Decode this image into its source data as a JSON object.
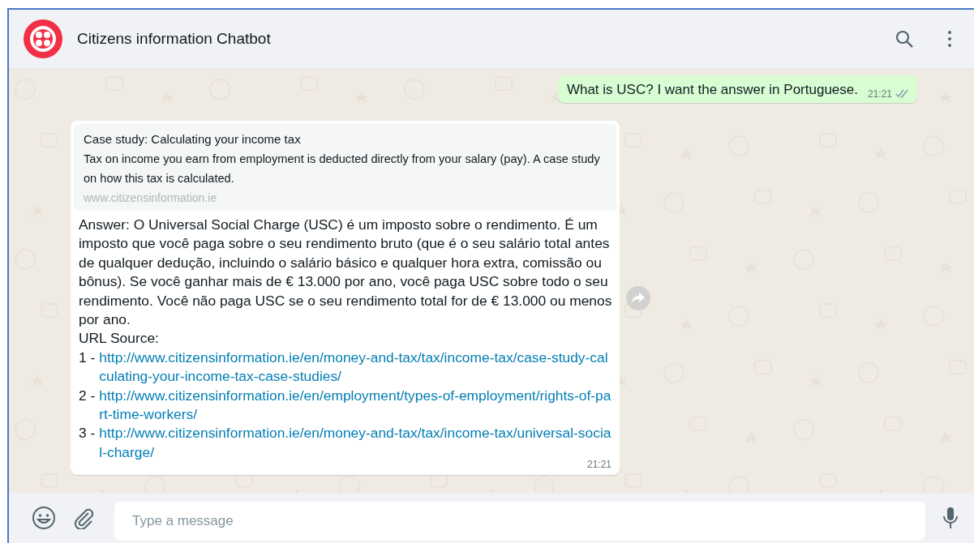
{
  "header": {
    "title": "Citizens information Chatbot"
  },
  "messages": [
    {
      "kind": "outgoing",
      "text": "What is USC? I want the answer in Portuguese.",
      "time": "21:21",
      "read": false
    },
    {
      "kind": "incoming",
      "preview": {
        "title": "Case study: Calculating your income tax",
        "description": "Tax on income you earn from employment is deducted directly from your salary (pay). A case study on how this tax is calculated.",
        "domain": "www.citizensinformation.ie"
      },
      "text": "Answer: O Universal Social Charge (USC) é um imposto sobre o rendimento. É um imposto que você paga sobre o seu rendimento bruto (que é o seu salário total antes de qualquer dedução, incluindo o salário básico e qualquer hora extra, comissão ou bônus). Se você ganhar mais de € 13.000 por ano, você paga USC sobre todo o seu rendimento. Você não paga USC se o seu rendimento total for de € 13.000 ou menos por ano.",
      "sources_label": "URL Source:",
      "sources": [
        {
          "number": "1 -",
          "url": "http://www.citizensinformation.ie/en/money-and-tax/tax/income-tax/case-study-calculating-your-income-tax-case-studies/"
        },
        {
          "number": "2 -",
          "url": "http://www.citizensinformation.ie/en/employment/types-of-employment/rights-of-part-time-workers/"
        },
        {
          "number": "3 -",
          "url": "http://www.citizensinformation.ie/en/money-and-tax/tax/income-tax/universal-social-charge/"
        }
      ],
      "time": "21:21"
    }
  ],
  "composer": {
    "placeholder": "Type a message"
  }
}
